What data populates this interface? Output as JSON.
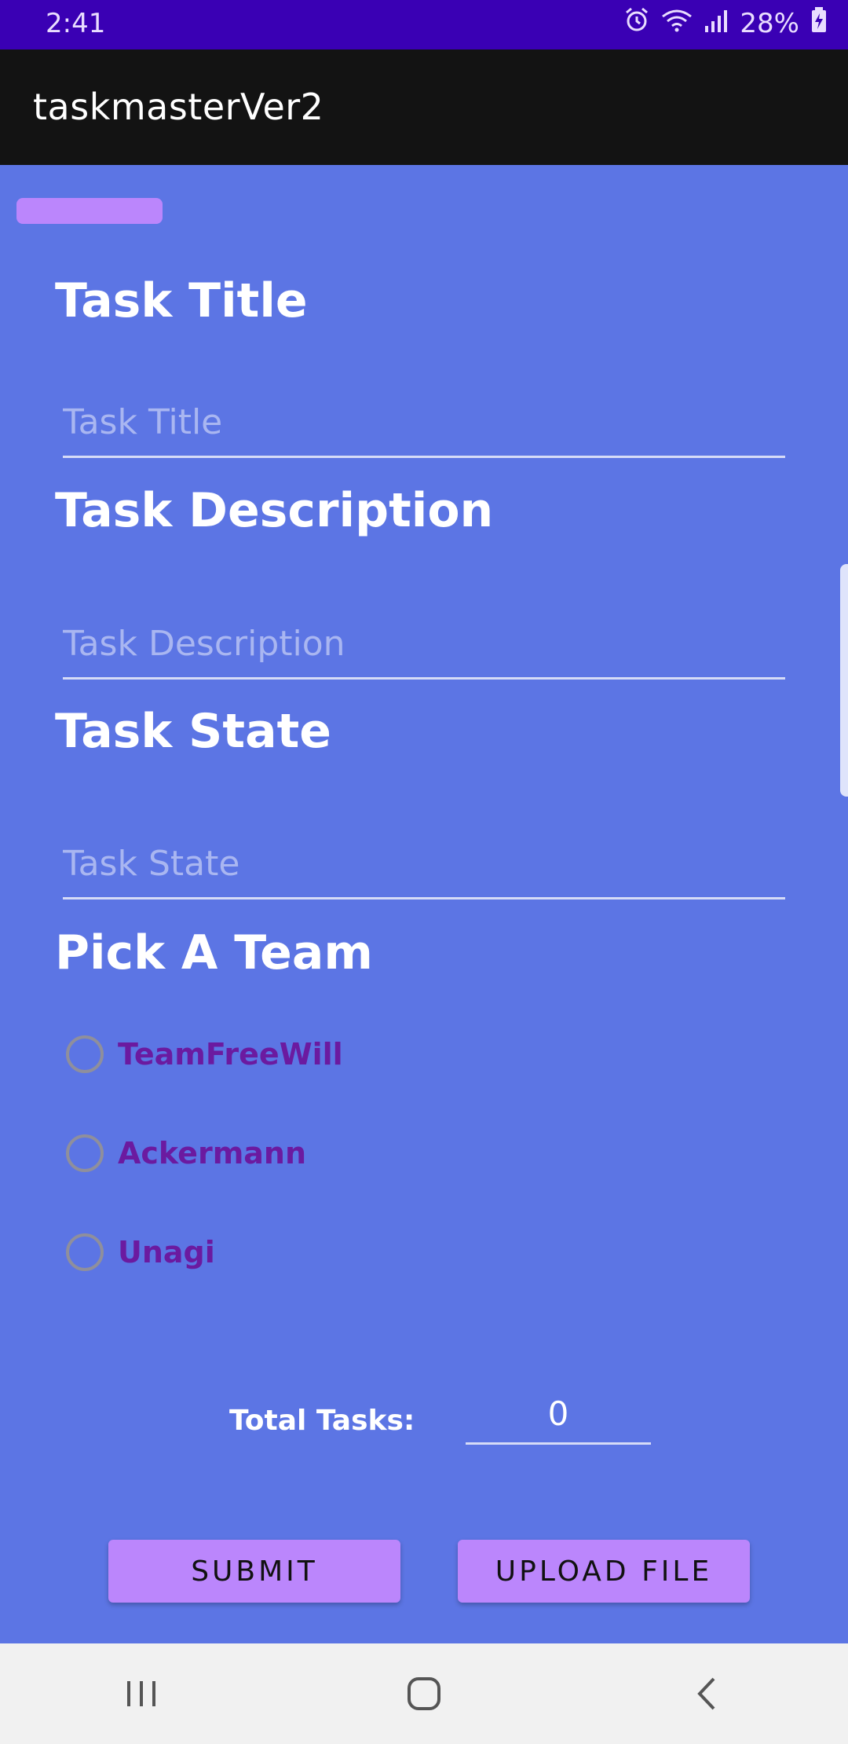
{
  "status_bar": {
    "time": "2:41",
    "battery": "28%",
    "icons": [
      "alarm-icon",
      "wifi-icon",
      "signal-icon",
      "battery-charging-icon"
    ]
  },
  "app_bar": {
    "title": "taskmasterVer2"
  },
  "form": {
    "task_title_label": "Task Title",
    "task_title_placeholder": "Task Title",
    "task_description_label": "Task Description",
    "task_description_placeholder": "Task Description",
    "task_state_label": "Task State",
    "task_state_placeholder": "Task State",
    "team_label": "Pick A Team",
    "teams": [
      {
        "label": "TeamFreeWill",
        "selected": false
      },
      {
        "label": "Ackermann",
        "selected": false
      },
      {
        "label": "Unagi",
        "selected": false
      }
    ],
    "total_tasks_label": "Total Tasks:",
    "total_tasks_value": "0",
    "submit_label": "SUBMIT",
    "upload_label": "UPLOAD FILE"
  },
  "colors": {
    "status_bar": "#3a00b4",
    "app_bar": "#131313",
    "background": "#5c75e4",
    "accent": "#bb86fc",
    "radio_text": "#6b1aa0"
  },
  "nav_bar": {
    "icons": [
      "recent-apps-icon",
      "home-icon",
      "back-icon"
    ]
  }
}
